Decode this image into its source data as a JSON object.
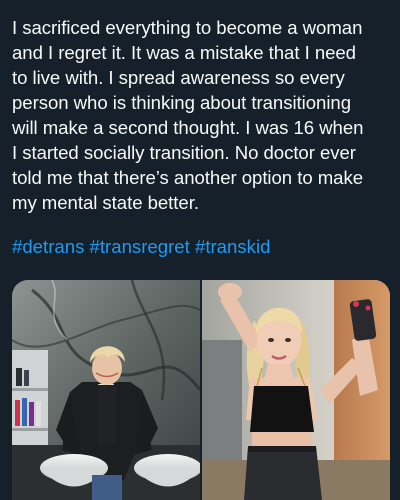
{
  "post": {
    "text": "I sacrificed everything to become a woman\nand I regret it. It was a mistake that I need\nto live with. I spread awareness so every\nperson who is thinking about transitioning\nwill make a second thought. I was 16 when\nI started socially transition. No doctor ever\ntold me that there’s another option to make\nmy mental state better.",
    "hashtags": [
      {
        "label": "#detrans"
      },
      {
        "label": "#transregret"
      },
      {
        "label": "#transkid"
      }
    ]
  },
  "media": [
    {
      "kind": "photo",
      "subject": "person-at-salon-sinks"
    },
    {
      "kind": "photo",
      "subject": "mirror-selfie"
    }
  ],
  "colors": {
    "background": "#15202b",
    "text": "#f7f9f9",
    "link": "#1d9bf0"
  }
}
